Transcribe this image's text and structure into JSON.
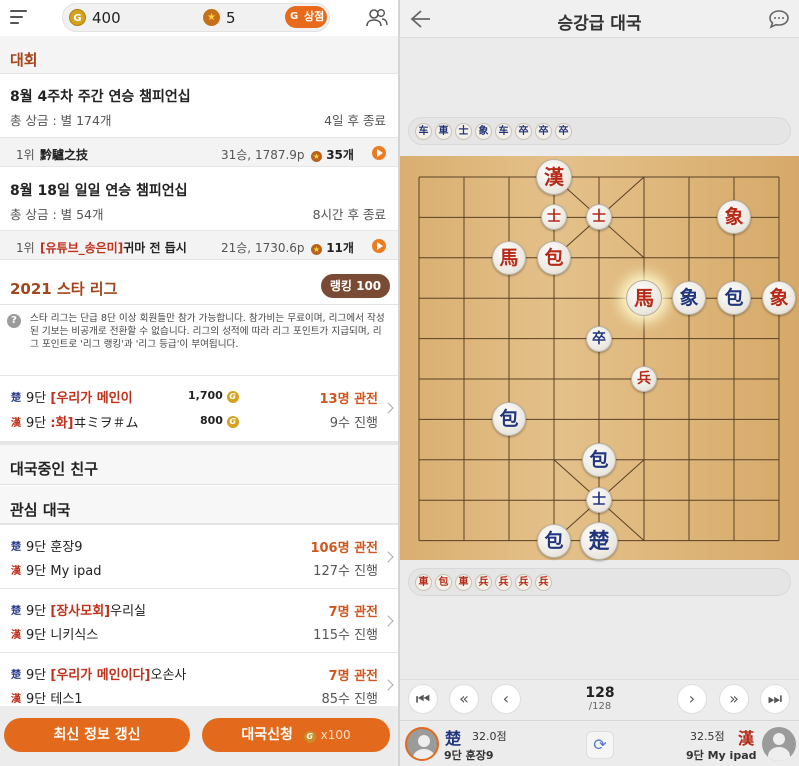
{
  "topbar": {
    "gold_icon": "G",
    "gold": "400",
    "star_icon": "★",
    "stars": "5",
    "shop_label": "상점",
    "shop_icon": "G"
  },
  "tournaments": {
    "section_title": "대회",
    "items": [
      {
        "title": "8월 4주차 주간 연승 챔피언십",
        "prize": "총 상금 : 별 174개",
        "ends": "4일 후 종료",
        "rank": "1위",
        "player": "黔驢之技",
        "club": "",
        "stats": "31승, 1787.9p",
        "stars": "35개"
      },
      {
        "title": "8월 18일 일일 연승 챔피언십",
        "prize": "총 상금 : 별 54개",
        "ends": "8시간 후 종료",
        "rank": "1위",
        "player": "귀마 전 듭시",
        "club": "[유튜브_송은미]",
        "stats": "21승, 1730.6p",
        "stars": "11개"
      }
    ]
  },
  "league": {
    "title": "2021 스타 리그",
    "ranking_label": "랭킹 100",
    "info_icon": "?",
    "info": "스타 리그는 단급 8단 이상 회원들만 참가 가능합니다. 참가비는 무료이며, 리그에서 작성된 기보는 비공개로 전환할 수 없습니다. 리그의 성적에 따라 리그 포인트가 지급되며, 리그 포인트로 '리그 랭킹'과 '리그 등급'이 부여됩니다.",
    "game": {
      "p1_side": "楚",
      "p1_rank": "9단",
      "p1_club": "[우리가 메인이",
      "p1_name": "",
      "p1_points": "1,700",
      "p2_side": "漢",
      "p2_rank": "9단",
      "p2_club": ":화]",
      "p2_name": "ヰミヲ＃ム",
      "p2_points": "800",
      "viewers": "13명 관전",
      "moves": "9수 진행"
    }
  },
  "friends_section": "대국중인 친구",
  "watch_section": "관심 대국",
  "watch_games": [
    {
      "p1_side": "楚",
      "p1_rank": "9단",
      "p1_club": "",
      "p1_name": "훈장9",
      "p2_side": "漢",
      "p2_rank": "9단",
      "p2_club": "",
      "p2_name": "My ipad",
      "viewers": "106명 관전",
      "moves": "127수 진행"
    },
    {
      "p1_side": "楚",
      "p1_rank": "9단",
      "p1_club": "[장사모회]",
      "p1_name": "우리실",
      "p2_side": "漢",
      "p2_rank": "9단",
      "p2_club": "",
      "p2_name": "니키식스",
      "viewers": "7명 관전",
      "moves": "115수 진행"
    },
    {
      "p1_side": "楚",
      "p1_rank": "9단",
      "p1_club": "[우리가 메인이다]",
      "p1_name": "오손사",
      "p2_side": "漢",
      "p2_rank": "9단",
      "p2_club": "",
      "p2_name": "테스1",
      "viewers": "7명 관전",
      "moves": "85수 진행"
    }
  ],
  "bottom": {
    "refresh_label": "최신 정보 갱신",
    "request_label": "대국신청",
    "request_cost_icon": "G",
    "request_cost": "x100"
  },
  "right": {
    "title": "승강급 대국",
    "top_captured": [
      "车",
      "車",
      "士",
      "象",
      "车",
      "卒",
      "卒",
      "卒"
    ],
    "bottom_captured": [
      "車",
      "包",
      "車",
      "兵",
      "兵",
      "兵",
      "兵"
    ],
    "pieces": [
      {
        "char": "漢",
        "color": "r",
        "role": "king"
      },
      {
        "char": "士",
        "color": "r",
        "role": "guard"
      },
      {
        "char": "士",
        "color": "r",
        "role": "guard"
      },
      {
        "char": "象",
        "color": "r",
        "role": "elephant"
      },
      {
        "char": "馬",
        "color": "r",
        "role": "horse"
      },
      {
        "char": "包",
        "color": "r",
        "role": "cannon"
      },
      {
        "char": "馬",
        "color": "r",
        "role": "horse",
        "highlighted": true
      },
      {
        "char": "象",
        "color": "b",
        "role": "elephant"
      },
      {
        "char": "包",
        "color": "b",
        "role": "cannon"
      },
      {
        "char": "象",
        "color": "r",
        "role": "elephant"
      },
      {
        "char": "卒",
        "color": "b",
        "role": "soldier"
      },
      {
        "char": "兵",
        "color": "r",
        "role": "soldier"
      },
      {
        "char": "包",
        "color": "b",
        "role": "cannon"
      },
      {
        "char": "包",
        "color": "b",
        "role": "cannon"
      },
      {
        "char": "士",
        "color": "b",
        "role": "guard"
      },
      {
        "char": "包",
        "color": "b",
        "role": "cannon"
      },
      {
        "char": "楚",
        "color": "b",
        "role": "king"
      }
    ],
    "move_current": "128",
    "move_total": "/128",
    "nav": [
      "⏮",
      "«",
      "‹",
      "›",
      "»",
      "⏭"
    ],
    "player_left": {
      "side": "楚",
      "score": "32.0점",
      "rank_name": "9단 훈장9"
    },
    "player_right": {
      "side": "漢",
      "score": "32.5점",
      "rank_name": "9단 My ipad"
    },
    "swap_icon": "⟳"
  },
  "colors": {
    "accent": "#e36a1c",
    "section_brown": "#a4451c",
    "blue_piece": "#22367d",
    "red_piece": "#b72a17",
    "board": "#dcb378"
  }
}
